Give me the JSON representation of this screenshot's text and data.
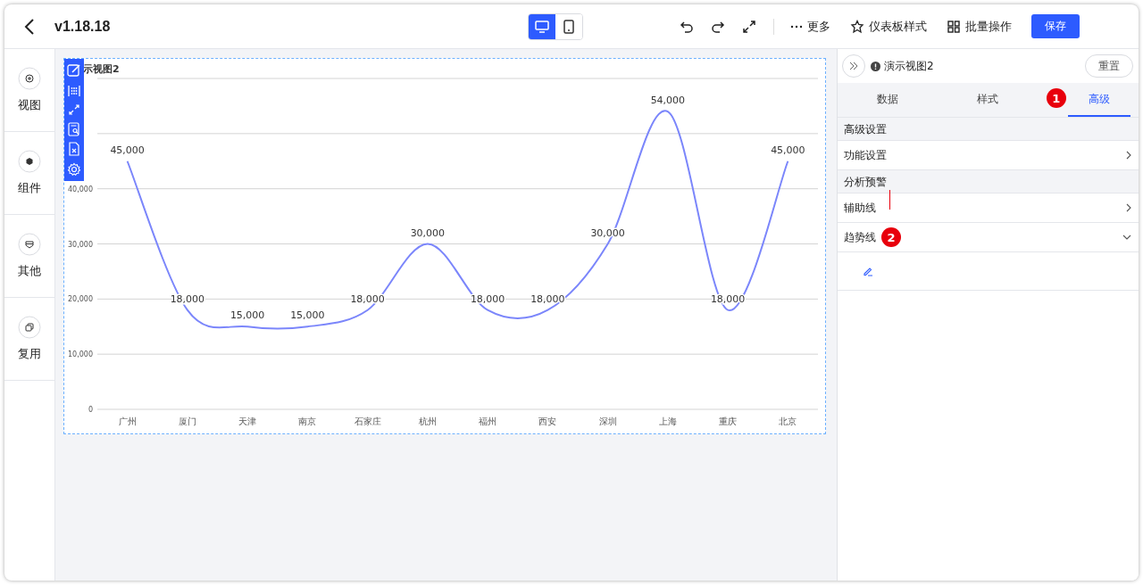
{
  "toolbar": {
    "title": "v1.18.18",
    "view_modes": [
      {
        "kind": "desktop",
        "selected": true
      },
      {
        "kind": "mobile",
        "selected": false
      }
    ],
    "more": "更多",
    "actions": [
      {
        "kind": "style",
        "label": "仪表板样式"
      },
      {
        "kind": "batch",
        "label": "批量操作"
      }
    ],
    "save": "保存"
  },
  "sidebar": [
    {
      "kind": "view",
      "label": "视图"
    },
    {
      "kind": "component",
      "label": "组件"
    },
    {
      "kind": "other",
      "label": "其他"
    },
    {
      "kind": "reuse",
      "label": "复用"
    }
  ],
  "chart_card": {
    "title": "示视图2",
    "chart_data": {
      "type": "line",
      "categories": [
        "广州",
        "厦门",
        "天津",
        "南京",
        "石家庄",
        "杭州",
        "福州",
        "西安",
        "深圳",
        "上海",
        "重庆",
        "北京"
      ],
      "series": [
        {
          "color": "#7b86fb",
          "values": [
            45000,
            18000,
            15000,
            15000,
            18000,
            30000,
            18000,
            18000,
            30000,
            54000,
            18000,
            45000
          ]
        }
      ],
      "ylim": [
        0,
        60000
      ],
      "yticks": [
        {
          "value": 0,
          "label": "0"
        },
        {
          "value": 10000,
          "label": "10,000"
        },
        {
          "value": 20000,
          "label": "20,000"
        },
        {
          "value": 30000,
          "label": "30,000"
        },
        {
          "value": 40000,
          "label": "40,000"
        }
      ],
      "grid": true,
      "value_labels": [
        "45,000",
        "18,000",
        "15,000",
        "15,000",
        "18,000",
        "30,000",
        "18,000",
        "18,000",
        "30,000",
        "54,000",
        "18,000",
        "45,000"
      ]
    }
  },
  "panel": {
    "title": "演示视图2",
    "reset": "重置",
    "tabs": [
      {
        "label": "数据",
        "selected": false
      },
      {
        "label": "样式",
        "selected": false
      },
      {
        "label": "高级",
        "selected": true,
        "badge": "1"
      }
    ],
    "sections": [
      {
        "header": "高级设置",
        "rows": [
          {
            "label": "功能设置",
            "expanded": false
          }
        ]
      },
      {
        "header": "分析预警",
        "rows": [
          {
            "label": "辅助线",
            "expanded": false
          },
          {
            "label": "趋势线",
            "expanded": true,
            "badge": "2"
          }
        ]
      }
    ]
  }
}
